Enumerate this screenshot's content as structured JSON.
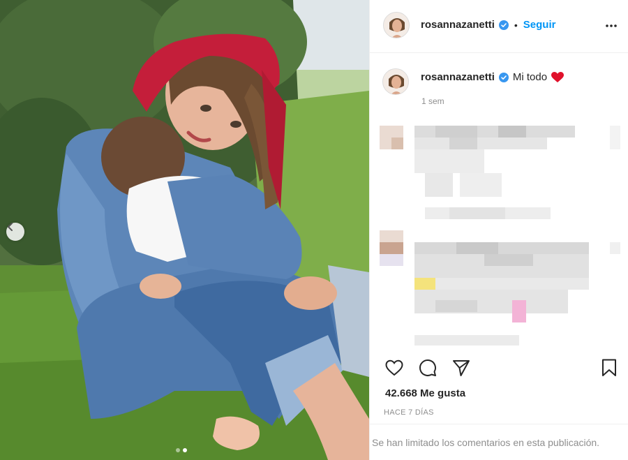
{
  "post": {
    "username": "rosannazanetti",
    "follow_label": "Seguir",
    "separator": "•",
    "caption_text": "Mi todo",
    "caption_emoji": "❤️",
    "caption_time": "1 sem",
    "likes_label": "42.668 Me gusta",
    "posted_ago": "HACE 7 DÍAS",
    "comments_limited": "Se han limitado los comentarios en esta publicación.",
    "carousel_dots": 2,
    "carousel_active_index": 1
  },
  "icons": {
    "verified": "verified-badge-icon",
    "more": "more-options-icon",
    "like": "heart-icon",
    "comment": "comment-icon",
    "share": "share-icon",
    "save": "bookmark-icon",
    "prev": "chevron-left-icon"
  },
  "colors": {
    "accent": "#0095f6",
    "verified": "#3897f0",
    "heart_emoji": "#e0112b",
    "muted": "#8e8e8e",
    "bandana": "#c41e3a"
  }
}
